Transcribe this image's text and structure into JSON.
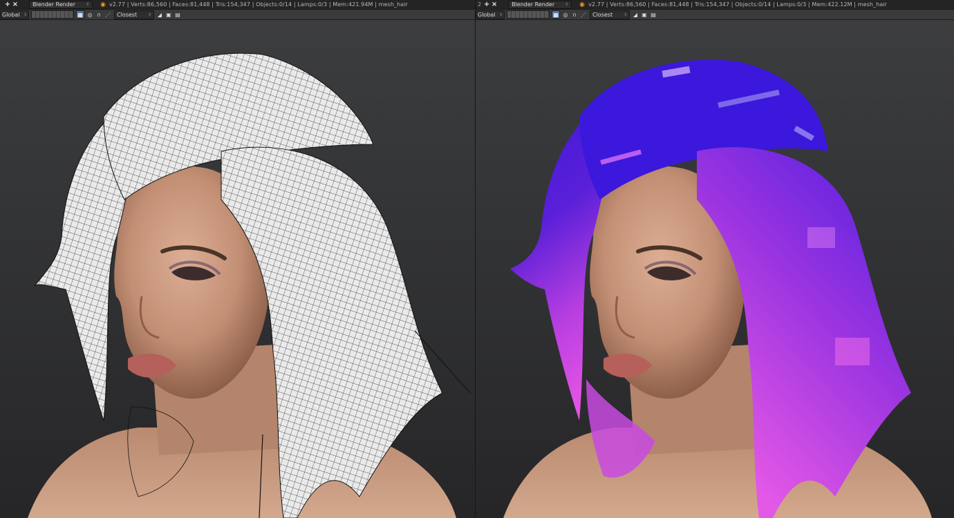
{
  "panes": [
    {
      "info": {
        "workspace_number": "",
        "add_icon": "+",
        "close_icon": "×",
        "engine": "Blender Render",
        "stats": "v2.77 | Verts:86,560 | Faces:81,448 | Tris:154,347 | Objects:0/14 | Lamps:0/3 | Mem:421.94M | mesh_hair"
      },
      "header": {
        "orientation": "Global",
        "snap_target": "Closest"
      },
      "viewport": {
        "hair_style": "wireframe-white"
      }
    },
    {
      "info": {
        "workspace_number": "2",
        "add_icon": "+",
        "close_icon": "×",
        "engine": "Blender Render",
        "stats": "v2.77 | Verts:86,560 | Faces:81,448 | Tris:154,347 | Objects:0/14 | Lamps:0/3 | Mem:422.12M | mesh_hair"
      },
      "header": {
        "orientation": "Global",
        "snap_target": "Closest"
      },
      "viewport": {
        "hair_style": "blue-magenta-gradient"
      }
    }
  ],
  "icons": {
    "blender_logo": "blender-logo-icon",
    "layers": "layer-grid",
    "proportional": "proportional-edit-icon",
    "snap": "snap-magnet-icon",
    "render": "render-icon"
  },
  "colors": {
    "info_bar": "#242424",
    "header_bar": "#3a3a3a",
    "viewport_top": "#3c3d3f",
    "viewport_bottom": "#262628",
    "skin": "#c99a80",
    "hair_blue": "#3a16d8",
    "hair_magenta": "#d84ae0",
    "hair_white": "#e6e6e6"
  }
}
